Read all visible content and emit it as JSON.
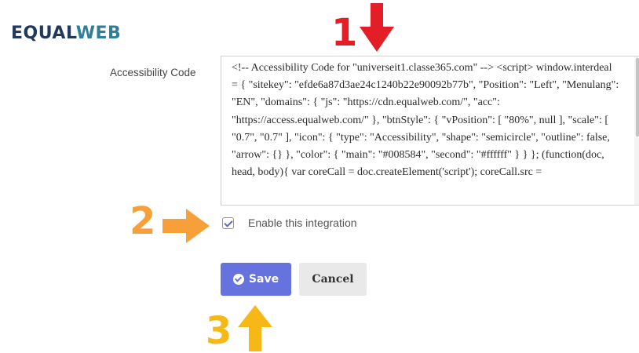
{
  "brand": {
    "logo_part1": "EQUAL",
    "logo_part2": "WEB"
  },
  "form": {
    "field_label": "Accessibility Code",
    "code_value": "<!-- Accessibility Code for \"universeit1.classe365.com\" --> <script> window.interdeal = { \"sitekey\": \"efde6a87d3ae24c1240b22e90092b77b\", \"Position\": \"Left\", \"Menulang\": \"EN\", \"domains\": { \"js\": \"https://cdn.equalweb.com/\", \"acc\": \"https://access.equalweb.com/\" }, \"btnStyle\": { \"vPosition\": [ \"80%\", null ], \"scale\": [ \"0.7\", \"0.7\" ], \"icon\": { \"type\": \"Accessibility\", \"shape\": \"semicircle\", \"outline\": false, \"arrow\": {} }, \"color\": { \"main\": \"#008584\", \"second\": \"#ffffff\" } } }; (function(doc, head, body){ var coreCall = doc.createElement('script'); coreCall.src =",
    "checkbox_label": "Enable this integration",
    "checkbox_checked": true,
    "save_label": "Save",
    "cancel_label": "Cancel"
  },
  "annotations": {
    "step1": "1",
    "step2": "2",
    "step3": "3"
  },
  "colors": {
    "accent": "#6673df",
    "arrow_red": "#e41e26",
    "arrow_orange": "#f7a03a",
    "arrow_yellow": "#f5b817"
  }
}
